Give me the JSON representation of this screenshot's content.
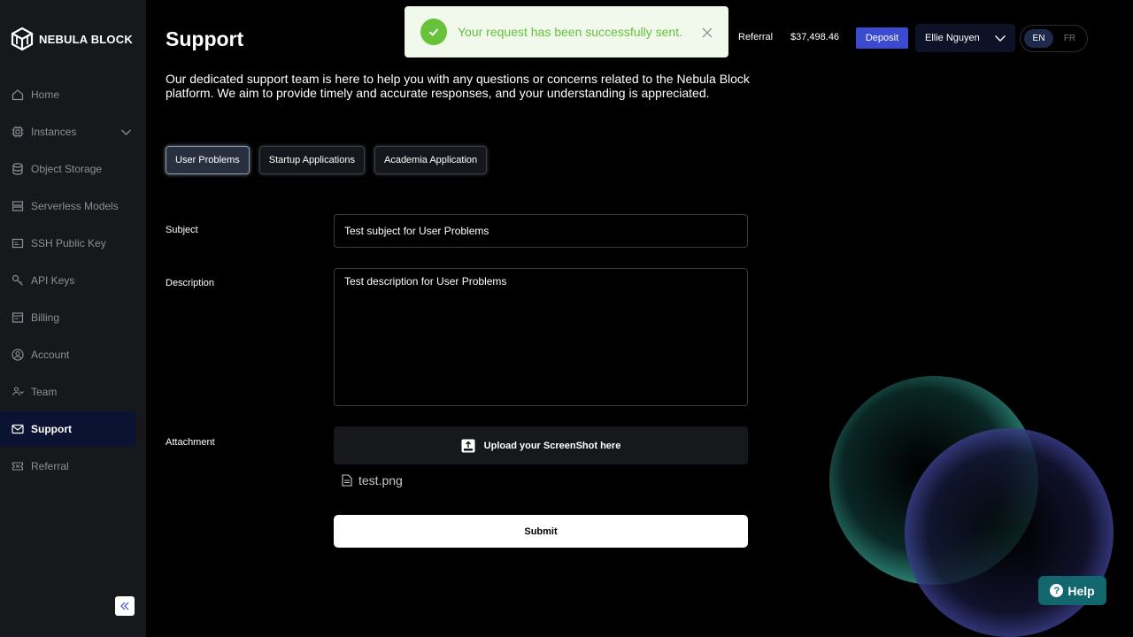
{
  "brand": {
    "name": "NEBULA BLOCK"
  },
  "sidebar": {
    "items": [
      {
        "label": "Home",
        "icon": "home-icon"
      },
      {
        "label": "Instances",
        "icon": "chip-icon"
      },
      {
        "label": "Object Storage",
        "icon": "database-icon"
      },
      {
        "label": "Serverless Models",
        "icon": "server-icon"
      },
      {
        "label": "SSH Public Key",
        "icon": "ssh-key-icon"
      },
      {
        "label": "API Keys",
        "icon": "key-icon"
      },
      {
        "label": "Billing",
        "icon": "billing-icon"
      },
      {
        "label": "Account",
        "icon": "account-icon"
      },
      {
        "label": "Team",
        "icon": "team-icon"
      },
      {
        "label": "Support",
        "icon": "mail-icon",
        "active": true
      },
      {
        "label": "Referral",
        "icon": "ticket-icon"
      }
    ]
  },
  "header": {
    "title": "Support",
    "referral": "Referral",
    "balance": "$37,498.46",
    "deposit": "Deposit",
    "user": "Ellie Nguyen",
    "languages": [
      "EN",
      "FR"
    ],
    "active_language": "EN"
  },
  "toast": {
    "message": "Your request has been successfully sent.",
    "type": "success"
  },
  "intro": "Our dedicated support team is here to help you with any questions or concerns related to the Nebula Block platform. We aim to provide timely and accurate responses, and your understanding is appreciated.",
  "tabs": [
    "User Problems",
    "Startup Applications",
    "Academia Application"
  ],
  "active_tab": "User Problems",
  "form": {
    "subject_label": "Subject",
    "subject_value": "Test subject for User Problems",
    "description_label": "Description",
    "description_value": "Test description for User Problems",
    "attachment_label": "Attachment",
    "upload_label": "Upload your ScreenShot here",
    "file_name": "test.png",
    "submit_label": "Submit"
  },
  "help": {
    "label": "Help"
  },
  "colors": {
    "accent": "#3b4bd0",
    "success": "#67c23a",
    "help": "#11676d",
    "sidebar_bg": "#17181c",
    "active_nav_bg": "#0c1232"
  }
}
